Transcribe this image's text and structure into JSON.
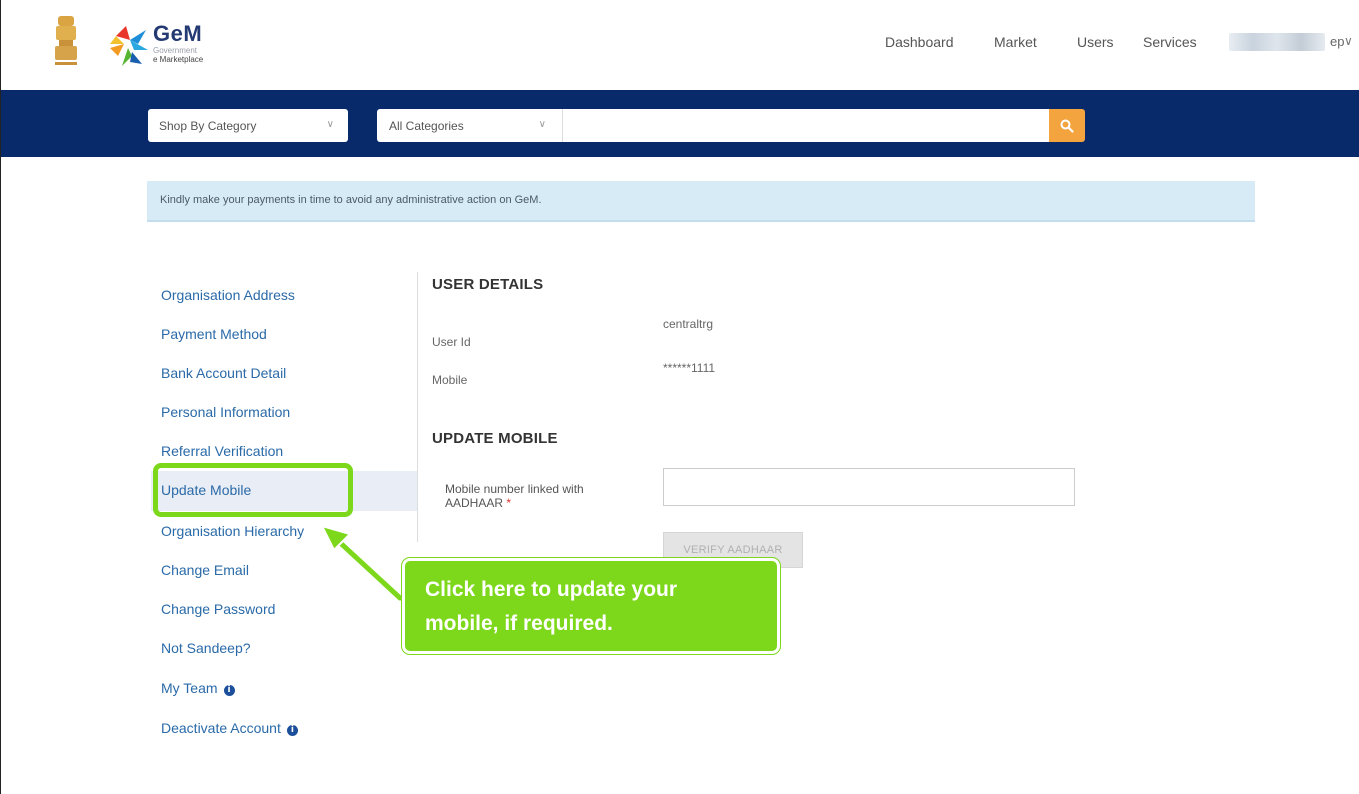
{
  "header": {
    "logo_title": "GeM",
    "logo_subtitle": "Government",
    "logo_subtitle2": "e Marketplace",
    "nav": [
      "Dashboard",
      "Market",
      "Users",
      "Services"
    ],
    "user_suffix": "ep",
    "user_chevron": "∨"
  },
  "search": {
    "shop_by_category": "Shop By Category",
    "all_categories": "All Categories",
    "placeholder": ""
  },
  "alert": {
    "text": "Kindly make your payments in time to avoid any administrative action on GeM."
  },
  "sidebar": {
    "items": [
      {
        "label": "Organisation Address"
      },
      {
        "label": "Payment Method"
      },
      {
        "label": "Bank Account Detail"
      },
      {
        "label": "Personal Information"
      },
      {
        "label": "Referral Verification"
      },
      {
        "label": "Update Mobile"
      },
      {
        "label": "Organisation Hierarchy"
      },
      {
        "label": "Change Email"
      },
      {
        "label": "Change Password"
      },
      {
        "label": "Not Sandeep?"
      },
      {
        "label": "My Team"
      },
      {
        "label": "Deactivate Account"
      }
    ],
    "info_glyph": "i"
  },
  "user_details": {
    "title": "USER DETAILS",
    "user_id_label": "User Id",
    "user_id_value": "centraltrg",
    "mobile_label": "Mobile",
    "mobile_value": "******1111"
  },
  "update_mobile": {
    "title": "UPDATE MOBILE",
    "field_label": "Mobile number linked with AADHAAR",
    "required_mark": "*",
    "field_value": "",
    "verify_button": "VERIFY AADHAAR"
  },
  "callout": {
    "line1": "Click here to update your",
    "line2": "mobile, if required."
  },
  "colors": {
    "navy": "#082a6b",
    "accent_orange": "#f3a43f",
    "link_blue": "#2a6aa8",
    "highlight_green": "#7dd81c"
  }
}
